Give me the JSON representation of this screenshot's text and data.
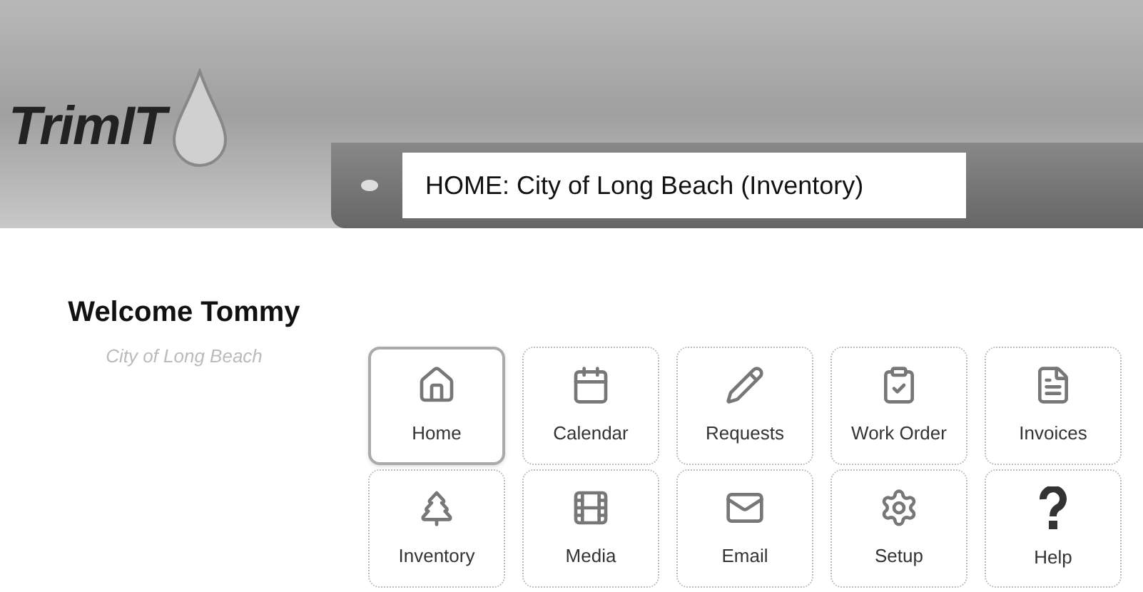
{
  "logo": {
    "text": "TrimIT"
  },
  "breadcrumb": {
    "value": "HOME: City of Long Beach (Inventory)"
  },
  "welcome": {
    "title": "Welcome Tommy",
    "subtitle": "City of Long Beach"
  },
  "tiles": [
    {
      "label": "Home",
      "selected": true
    },
    {
      "label": "Calendar",
      "selected": false
    },
    {
      "label": "Requests",
      "selected": false
    },
    {
      "label": "Work Order",
      "selected": false
    },
    {
      "label": "Invoices",
      "selected": false
    },
    {
      "label": "Inventory",
      "selected": false
    },
    {
      "label": "Media",
      "selected": false
    },
    {
      "label": "Email",
      "selected": false
    },
    {
      "label": "Setup",
      "selected": false
    },
    {
      "label": "Help",
      "selected": false
    }
  ]
}
